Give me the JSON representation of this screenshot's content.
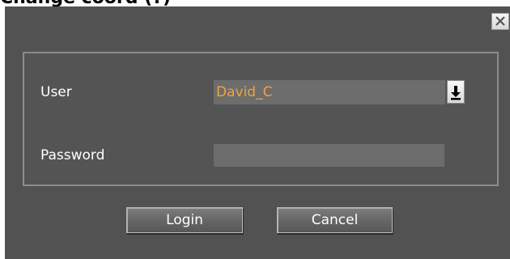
{
  "window": {
    "caption_partial": "Change coord (?)"
  },
  "form": {
    "user_label": "User",
    "user_value": "David_C",
    "password_label": "Password",
    "password_value": ""
  },
  "buttons": {
    "login_label": "Login",
    "cancel_label": "Cancel"
  },
  "icons": {
    "close": "close-icon",
    "dropdown": "download-arrow-icon"
  },
  "colors": {
    "dialog_bg": "#525252",
    "user_value_text": "#f3a23d",
    "field_bg": "#6d6d6d"
  }
}
